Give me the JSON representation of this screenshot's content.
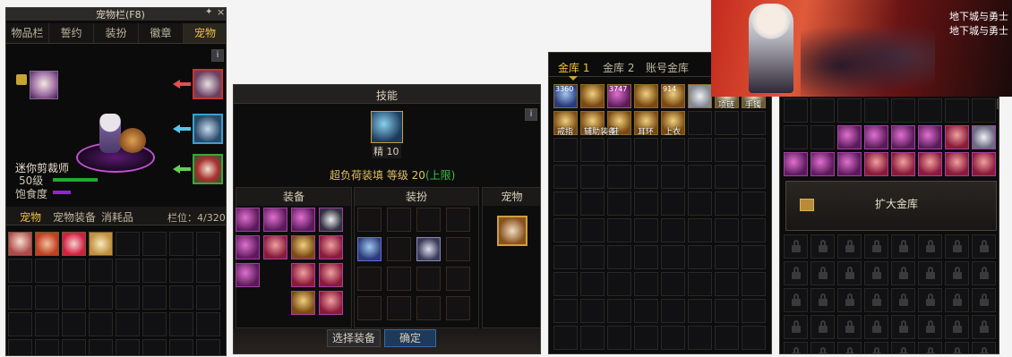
{
  "pet_window": {
    "title": "宠物栏(F8)",
    "tabs": [
      "物品栏",
      "誓约",
      "装扮",
      "徽章",
      "宠物"
    ],
    "active_tab": "宠物",
    "pet_name": "迷你剪裁师",
    "pet_level": "50级",
    "satiety_label": "饱食度",
    "sub_tabs": [
      "宠物",
      "宠物装备",
      "消耗品"
    ],
    "slot_count": "栏位：4/320",
    "info": "i"
  },
  "skill_window": {
    "title": "技能",
    "skill_level": "精 10",
    "skill_desc": "超负荷装填 等级 20",
    "skill_cap": "(上限)",
    "sections": [
      "装备",
      "装扮",
      "宠物"
    ],
    "select_button": "选择装备",
    "confirm_button": "确定",
    "info": "i"
  },
  "vault_window": {
    "tabs": [
      "金库 1",
      "金库 2",
      "账号金库"
    ],
    "counts": [
      "3360",
      "3747",
      "914"
    ],
    "item_labels": [
      "项链",
      "手镯",
      "戒指",
      "辅助装备",
      "鞋",
      "耳环",
      "上衣"
    ]
  },
  "banner": {
    "logo_line1": "地下城与勇士",
    "logo_line2": "地下城与勇士"
  },
  "account_vault": {
    "expand_button": "扩大金库",
    "info": "i"
  }
}
